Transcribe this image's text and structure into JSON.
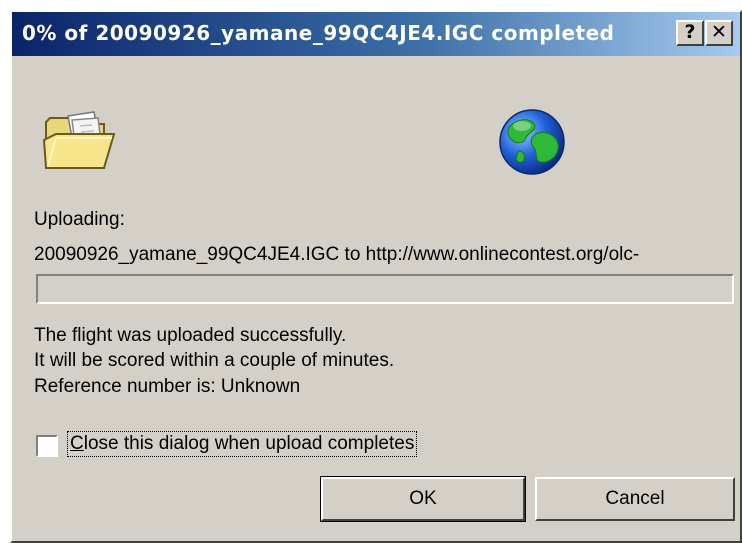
{
  "window": {
    "title": "0% of 20090926_yamane_99QC4JE4.IGC completed",
    "help_label": "?",
    "close_label": "✕"
  },
  "icons": {
    "folder": "open-folder-icon",
    "globe": "globe-icon"
  },
  "status": {
    "uploading_label": "Uploading:",
    "detail": "20090926_yamane_99QC4JE4.IGC to http://www.onlinecontest.org/olc-"
  },
  "progress": {
    "percent": 0
  },
  "messages": {
    "line1": "The flight was uploaded successfully.",
    "line2": "It will be scored within a couple of minutes.",
    "line3": "Reference number is: Unknown"
  },
  "option": {
    "close_on_complete_first": "C",
    "close_on_complete_rest": "lose this dialog when upload completes",
    "checked": false
  },
  "buttons": {
    "ok": "OK",
    "cancel": "Cancel"
  },
  "colors": {
    "dialog_face": "#d4d0c8",
    "title_start": "#0a246a",
    "title_end": "#a6caf0"
  }
}
